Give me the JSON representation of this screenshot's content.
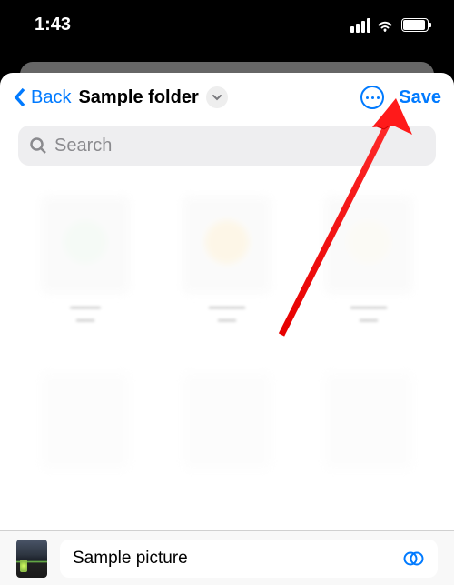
{
  "status": {
    "time": "1:43"
  },
  "nav": {
    "back_label": "Back",
    "title": "Sample folder",
    "save_label": "Save"
  },
  "search": {
    "placeholder": "Search"
  },
  "bottom": {
    "file_name": "Sample picture"
  },
  "colors": {
    "accent": "#007aff"
  }
}
